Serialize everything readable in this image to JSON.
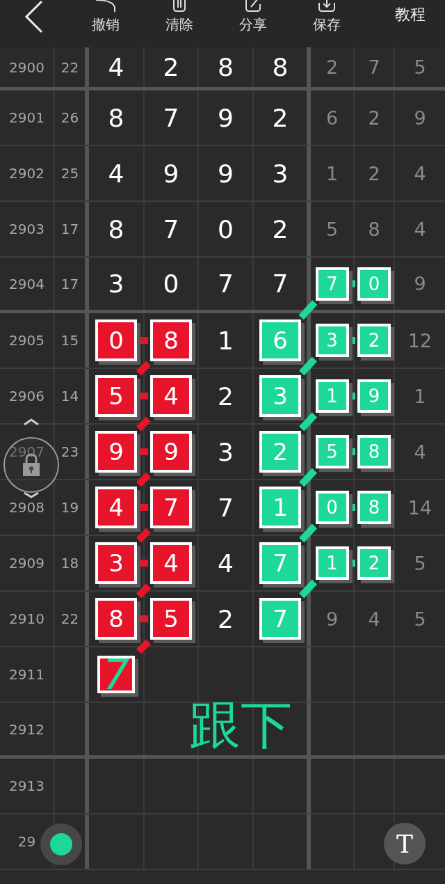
{
  "toolbar": {
    "buttons": [
      {
        "kind": "undo",
        "label": "撤销"
      },
      {
        "kind": "clear",
        "label": "清除"
      },
      {
        "kind": "share",
        "label": "分享"
      },
      {
        "kind": "save",
        "label": "保存"
      }
    ],
    "tutorial": "教程"
  },
  "rows": [
    {
      "period": "2900",
      "sum": "22",
      "section_end": true,
      "cells": [
        {
          "text": "4"
        },
        {
          "text": "2"
        },
        {
          "text": "8"
        },
        {
          "text": "8"
        },
        {
          "text": "2"
        },
        {
          "text": "7"
        },
        {
          "text": "5"
        }
      ]
    },
    {
      "period": "2901",
      "sum": "26",
      "section_end": false,
      "cells": [
        {
          "text": "8"
        },
        {
          "text": "7"
        },
        {
          "text": "9"
        },
        {
          "text": "2"
        },
        {
          "text": "6"
        },
        {
          "text": "2"
        },
        {
          "text": "9"
        }
      ]
    },
    {
      "period": "2902",
      "sum": "25",
      "section_end": false,
      "cells": [
        {
          "text": "4"
        },
        {
          "text": "9"
        },
        {
          "text": "9"
        },
        {
          "text": "3"
        },
        {
          "text": "1"
        },
        {
          "text": "2"
        },
        {
          "text": "4"
        }
      ]
    },
    {
      "period": "2903",
      "sum": "17",
      "section_end": false,
      "cells": [
        {
          "text": "8"
        },
        {
          "text": "7"
        },
        {
          "text": "0"
        },
        {
          "text": "2"
        },
        {
          "text": "5"
        },
        {
          "text": "8"
        },
        {
          "text": "4"
        }
      ]
    },
    {
      "period": "2904",
      "sum": "17",
      "section_end": true,
      "cells": [
        {
          "text": "3"
        },
        {
          "text": "0"
        },
        {
          "text": "7"
        },
        {
          "text": "7"
        },
        {
          "text": "7",
          "color": "#1ed898",
          "link_right": true,
          "link_down_left": true
        },
        {
          "text": "0",
          "color": "#1ed898"
        },
        {
          "text": "9"
        }
      ]
    },
    {
      "period": "2905",
      "sum": "15",
      "section_end": false,
      "cells": [
        {
          "text": "0",
          "color": "#e8142c",
          "link_right": true
        },
        {
          "text": "8",
          "color": "#e8142c",
          "link_down_left": true
        },
        {
          "text": "1"
        },
        {
          "text": "6",
          "color": "#1ed898"
        },
        {
          "text": "3",
          "color": "#1ed898",
          "link_right": true,
          "link_down_left": true
        },
        {
          "text": "2",
          "color": "#1ed898"
        },
        {
          "text": "12"
        }
      ]
    },
    {
      "period": "2906",
      "sum": "14",
      "section_end": false,
      "cells": [
        {
          "text": "5",
          "color": "#e8142c",
          "link_right": true
        },
        {
          "text": "4",
          "color": "#e8142c",
          "link_down_left": true
        },
        {
          "text": "2"
        },
        {
          "text": "3",
          "color": "#1ed898"
        },
        {
          "text": "1",
          "color": "#1ed898",
          "link_right": true,
          "link_down_left": true
        },
        {
          "text": "9",
          "color": "#1ed898"
        },
        {
          "text": "1"
        }
      ]
    },
    {
      "period": "2907",
      "sum": "23",
      "section_end": false,
      "cells": [
        {
          "text": "9",
          "color": "#e8142c",
          "link_right": true
        },
        {
          "text": "9",
          "color": "#e8142c",
          "link_down_left": true
        },
        {
          "text": "3"
        },
        {
          "text": "2",
          "color": "#1ed898"
        },
        {
          "text": "5",
          "color": "#1ed898",
          "link_right": true,
          "link_down_left": true
        },
        {
          "text": "8",
          "color": "#1ed898"
        },
        {
          "text": "4"
        }
      ]
    },
    {
      "period": "2908",
      "sum": "19",
      "section_end": false,
      "cells": [
        {
          "text": "4",
          "color": "#e8142c",
          "link_right": true
        },
        {
          "text": "7",
          "color": "#e8142c",
          "link_down_left": true
        },
        {
          "text": "7"
        },
        {
          "text": "1",
          "color": "#1ed898"
        },
        {
          "text": "0",
          "color": "#1ed898",
          "link_right": true,
          "link_down_left": true
        },
        {
          "text": "8",
          "color": "#1ed898"
        },
        {
          "text": "14"
        }
      ]
    },
    {
      "period": "2909",
      "sum": "18",
      "section_end": false,
      "cells": [
        {
          "text": "3",
          "color": "#e8142c",
          "link_right": true
        },
        {
          "text": "4",
          "color": "#e8142c",
          "link_down_left": true
        },
        {
          "text": "4"
        },
        {
          "text": "7",
          "color": "#1ed898"
        },
        {
          "text": "1",
          "color": "#1ed898",
          "link_right": true,
          "link_down_left": true
        },
        {
          "text": "2",
          "color": "#1ed898"
        },
        {
          "text": "5"
        }
      ]
    },
    {
      "period": "2910",
      "sum": "22",
      "section_end": false,
      "cells": [
        {
          "text": "8",
          "color": "#e8142c",
          "link_right": true
        },
        {
          "text": "5",
          "color": "#e8142c",
          "link_down_left": true
        },
        {
          "text": "2"
        },
        {
          "text": "7",
          "color": "#1ed898"
        },
        {
          "text": "9"
        },
        {
          "text": "4"
        },
        {
          "text": "5"
        }
      ]
    },
    {
      "period": "2911",
      "section_end": false,
      "cells": [
        {
          "text": "7",
          "color": "#e8142c",
          "handwritten": true
        }
      ]
    },
    {
      "period": "2912",
      "section_end": true,
      "cells": []
    },
    {
      "period": "2913",
      "section_end": false,
      "cells": []
    },
    {
      "period": "29",
      "section_end": false,
      "cells": []
    }
  ],
  "annotation": {
    "text": "跟下"
  },
  "text_tool": {
    "label": "T"
  }
}
